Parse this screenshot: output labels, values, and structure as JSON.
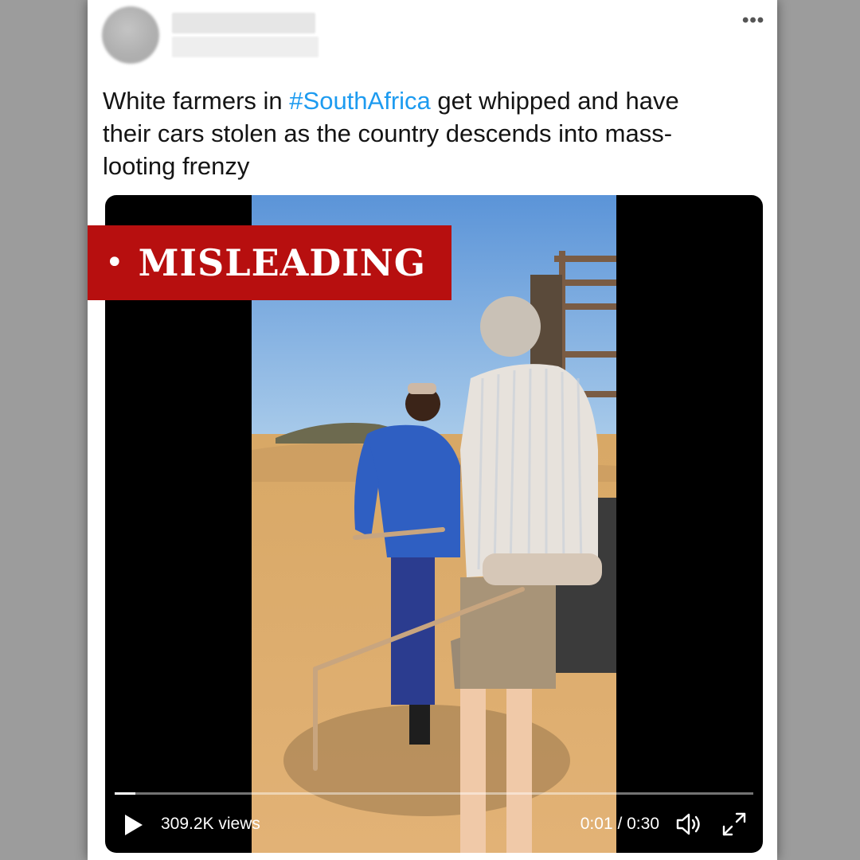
{
  "tweet": {
    "text_before": "White farmers in ",
    "hashtag": "#SouthAfrica",
    "text_after": " get whipped and have their cars stolen as the country descends into mass-looting frenzy",
    "more_label": "•••"
  },
  "overlay": {
    "dot": "•",
    "label": "MISLEADING"
  },
  "video": {
    "views": "309.2K views",
    "time": "0:01 / 0:30",
    "progress": 0.033
  },
  "colors": {
    "badge": "#b70f0f",
    "hashtag": "#1d9bf0"
  },
  "icons": {
    "play": "play-icon",
    "volume": "volume-icon",
    "fullscreen": "fullscreen-icon",
    "more": "more-icon"
  }
}
